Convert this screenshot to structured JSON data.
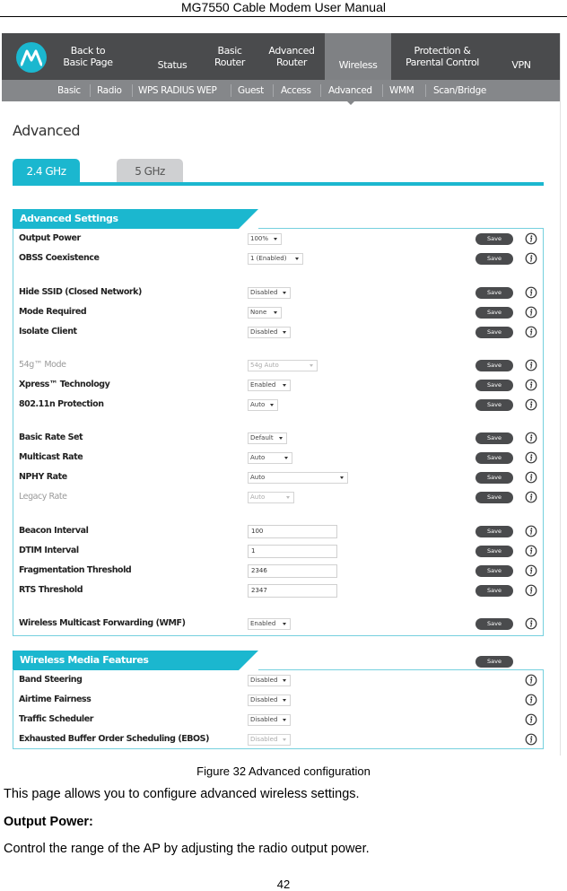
{
  "document": {
    "header": "MG7550 Cable Modem User Manual",
    "caption": "Figure 32 Advanced configuration",
    "paragraph1": "This page allows you to configure advanced wireless settings.",
    "heading": "Output Power:",
    "paragraph2": "Control the range of the AP by adjusting the radio output power.",
    "page_number": "42"
  },
  "topnav": {
    "logo_icon": "motorola-logo-icon",
    "items": [
      {
        "line1": "Back to",
        "line2": "Basic Page"
      },
      {
        "line1": "",
        "line2": "Status"
      },
      {
        "line1": "Basic",
        "line2": "Router"
      },
      {
        "line1": "Advanced",
        "line2": "Router"
      },
      {
        "line1": "",
        "line2": "Wireless",
        "active": true
      },
      {
        "line1": "Protection &",
        "line2": "Parental Control"
      },
      {
        "line1": "",
        "line2": "VPN"
      }
    ]
  },
  "subnav": {
    "items": [
      "Basic",
      "Radio",
      "WPS RADIUS WEP",
      "Guest",
      "Access",
      "Advanced",
      "WMM",
      "Scan/Bridge"
    ],
    "active": "Advanced"
  },
  "page": {
    "title": "Advanced",
    "tabs": [
      {
        "label": "2.4 GHz",
        "active": true
      },
      {
        "label": "5 GHz",
        "active": false
      }
    ]
  },
  "colors": {
    "accent": "#1bb7cf",
    "nav_bg": "#4a4b4d",
    "nav_active": "#7f8184",
    "subnav_bg": "#85878a",
    "save_button": "#4a4b4d"
  },
  "advanced_settings": {
    "title": "Advanced Settings",
    "save_label": "Save",
    "rows": [
      {
        "label": "Output Power",
        "type": "select",
        "value": "100%"
      },
      {
        "label": "OBSS Coexistence",
        "type": "select",
        "value": "1 (Enabled)"
      },
      {
        "label": "Hide SSID (Closed Network)",
        "type": "select",
        "value": "Disabled"
      },
      {
        "label": "Mode Required",
        "type": "select",
        "value": "None"
      },
      {
        "label": "Isolate Client",
        "type": "select",
        "value": "Disabled"
      },
      {
        "label": "54g™ Mode",
        "type": "select",
        "value": "54g Auto",
        "disabled": true
      },
      {
        "label": "Xpress™ Technology",
        "type": "select",
        "value": "Enabled"
      },
      {
        "label": "802.11n Protection",
        "type": "select",
        "value": "Auto"
      },
      {
        "label": "Basic Rate Set",
        "type": "select",
        "value": "Default"
      },
      {
        "label": "Multicast Rate",
        "type": "select",
        "value": "Auto"
      },
      {
        "label": "NPHY Rate",
        "type": "select",
        "value": "Auto"
      },
      {
        "label": "Legacy Rate",
        "type": "select",
        "value": "Auto",
        "disabled": true
      },
      {
        "label": "Beacon Interval",
        "type": "text",
        "value": "100"
      },
      {
        "label": "DTIM Interval",
        "type": "text",
        "value": "1"
      },
      {
        "label": "Fragmentation Threshold",
        "type": "text",
        "value": "2346"
      },
      {
        "label": "RTS Threshold",
        "type": "text",
        "value": "2347"
      },
      {
        "label": "Wireless Multicast Forwarding (WMF)",
        "type": "select",
        "value": "Enabled"
      }
    ]
  },
  "wireless_media": {
    "title": "Wireless Media Features",
    "save_label": "Save",
    "rows": [
      {
        "label": "Band Steering",
        "type": "select",
        "value": "Disabled"
      },
      {
        "label": "Airtime Fairness",
        "type": "select",
        "value": "Disabled"
      },
      {
        "label": "Traffic Scheduler",
        "type": "select",
        "value": "Disabled"
      },
      {
        "label": "Exhausted Buffer Order Scheduling (EBOS)",
        "type": "select",
        "value": "Disabled",
        "disabled": true
      }
    ]
  }
}
